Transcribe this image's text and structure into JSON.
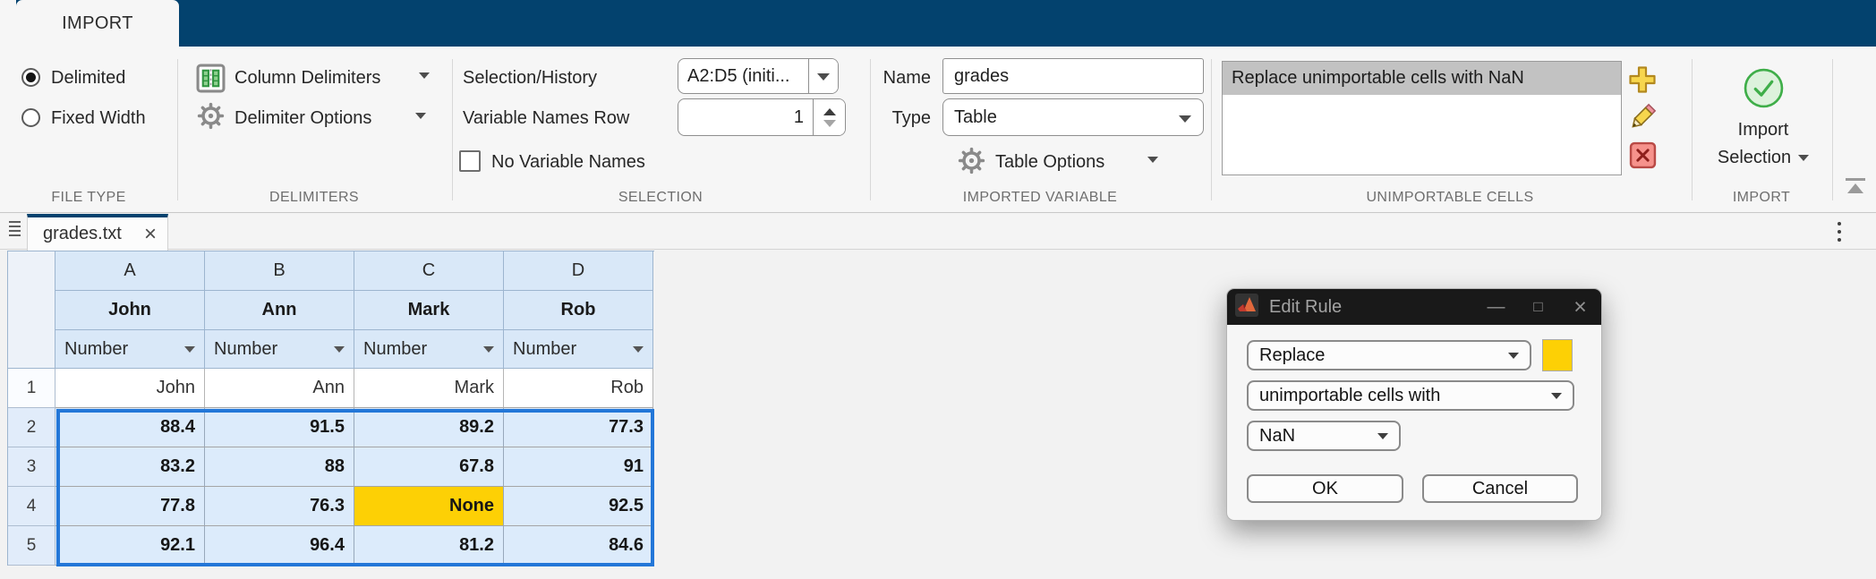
{
  "colors": {
    "header_blue": "#03426e",
    "selection_blue": "#2377d8",
    "highlight_yellow": "#fdd005",
    "check_green": "#3fae49"
  },
  "ribbon": {
    "tab_label": "IMPORT",
    "file_type": {
      "section_label": "FILE TYPE",
      "delimited_label": "Delimited",
      "fixed_width_label": "Fixed Width"
    },
    "delimiters": {
      "section_label": "DELIMITERS",
      "column_delimiters_label": "Column Delimiters",
      "delimiter_options_label": "Delimiter Options"
    },
    "selection": {
      "section_label": "SELECTION",
      "history_label": "Selection/History",
      "history_value": "A2:D5 (initi...",
      "var_names_row_label": "Variable Names Row",
      "var_names_row_value": "1",
      "no_var_names_label": "No Variable Names"
    },
    "imported_variable": {
      "section_label": "IMPORTED VARIABLE",
      "name_label": "Name",
      "name_value": "grades",
      "type_label": "Type",
      "type_value": "Table",
      "table_options_label": "Table Options"
    },
    "unimportable_cells": {
      "section_label": "UNIMPORTABLE CELLS",
      "rules": [
        {
          "text": "Replace unimportable cells with NaN"
        }
      ]
    },
    "import": {
      "section_label": "IMPORT",
      "button_line1": "Import",
      "button_line2": "Selection"
    }
  },
  "document": {
    "tab_title": "grades.txt",
    "grid": {
      "column_letters": [
        "A",
        "B",
        "C",
        "D"
      ],
      "column_names": [
        "John",
        "Ann",
        "Mark",
        "Rob"
      ],
      "column_types": [
        "Number",
        "Number",
        "Number",
        "Number"
      ],
      "row_numbers": [
        "1",
        "2",
        "3",
        "4",
        "5"
      ],
      "rows": [
        [
          "John",
          "Ann",
          "Mark",
          "Rob"
        ],
        [
          "88.4",
          "91.5",
          "89.2",
          "77.3"
        ],
        [
          "83.2",
          "88",
          "67.8",
          "91"
        ],
        [
          "77.8",
          "76.3",
          "None",
          "92.5"
        ],
        [
          "92.1",
          "96.4",
          "81.2",
          "84.6"
        ]
      ]
    }
  },
  "dialog": {
    "title": "Edit Rule",
    "action_value": "Replace",
    "target_value": "unimportable cells with",
    "replacement_value": "NaN",
    "ok_label": "OK",
    "cancel_label": "Cancel"
  }
}
